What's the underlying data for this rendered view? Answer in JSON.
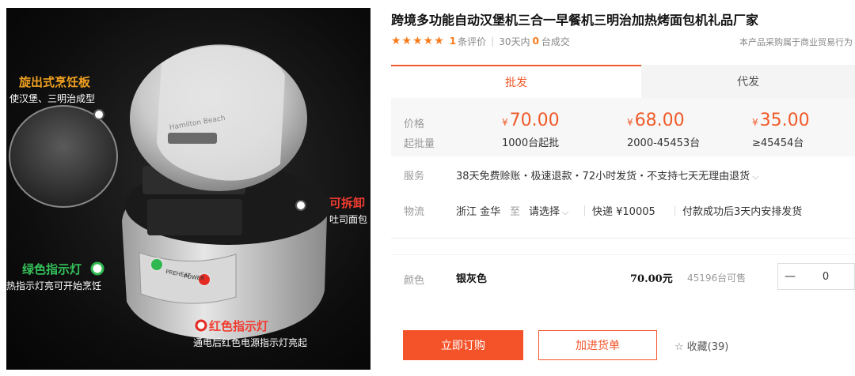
{
  "image": {
    "callouts": [
      {
        "title": "旋出式烹饪板",
        "desc": "使汉堡、三明治成型"
      },
      {
        "title": "可拆卸",
        "desc": "吐司面包"
      },
      {
        "title": "绿色指示灯",
        "desc": "热指示灯亮可开始烹饪"
      },
      {
        "title": "红色指示灯",
        "desc": "通电后红色电源指示灯亮起"
      }
    ],
    "brand_text": "Hamilton Beach",
    "lights": {
      "green": "PREHEAT",
      "red": "POWER"
    },
    "colors": {
      "orange": "#f0a020",
      "red": "#f03c30",
      "green": "#34c05a"
    }
  },
  "product": {
    "title": "跨境多功能自动汉堡机三合一早餐机三明治加热烤面包机礼品厂家",
    "stars": "★★★★★",
    "review_count": "1",
    "review_label": "条评价",
    "sold_prefix": "30天内",
    "sold_count": "0",
    "sold_suffix": "台成交",
    "purpose_note": "本产品采购属于商业贸易行为"
  },
  "tabs": {
    "wholesale": "批发",
    "dropship": "代发"
  },
  "pricing": {
    "price_label": "价格",
    "moq_label": "起批量",
    "currency": "¥",
    "tiers": [
      {
        "price": "70.00",
        "moq": "1000台起批"
      },
      {
        "price": "68.00",
        "moq": "2000-45453台"
      },
      {
        "price": "35.00",
        "moq": "≥45454台"
      }
    ]
  },
  "service": {
    "label": "服务",
    "value": "38天免费赊账・极速退款・72小时发货・不支持七天无理由退货"
  },
  "logistics": {
    "label": "物流",
    "origin": "浙江 金华",
    "to": "至",
    "dest": "请选择",
    "shipping": "快递 ¥10005",
    "dispatch": "付款成功后3天内安排发货"
  },
  "sku": {
    "label": "颜色",
    "name": "银灰色",
    "price": "70.00元",
    "stock": "45196台可售",
    "minus": "—",
    "qty": "0"
  },
  "actions": {
    "order": "立即订购",
    "cart": "加进货单",
    "favorite": "收藏(39)"
  },
  "accent": "#f05a28"
}
